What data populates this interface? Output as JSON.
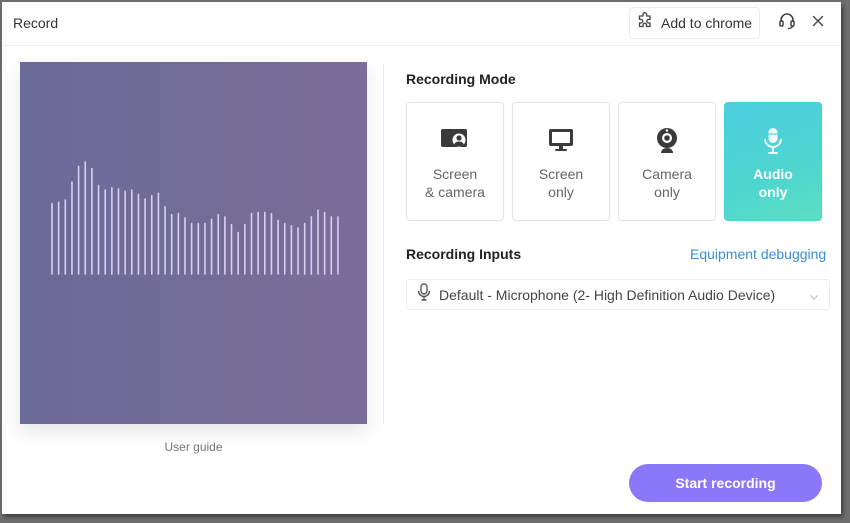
{
  "window": {
    "title": "Record",
    "add_to_chrome_label": "Add to chrome",
    "support_icon": "headset-icon",
    "close_icon": "close-icon"
  },
  "preview": {
    "user_guide_label": "User guide",
    "waveform_levels": [
      0.63,
      0.64,
      0.66,
      0.82,
      0.96,
      1.0,
      0.94,
      0.79,
      0.75,
      0.77,
      0.76,
      0.74,
      0.75,
      0.71,
      0.67,
      0.7,
      0.72,
      0.6,
      0.53,
      0.54,
      0.5,
      0.45,
      0.45,
      0.45,
      0.49,
      0.53,
      0.51,
      0.44,
      0.37,
      0.44,
      0.54,
      0.55,
      0.55,
      0.54,
      0.48,
      0.45,
      0.43,
      0.41,
      0.45,
      0.51,
      0.57,
      0.55,
      0.51,
      0.51
    ]
  },
  "recording_mode": {
    "title": "Recording Mode",
    "options": [
      {
        "label_line1": "Screen",
        "label_line2": "& camera",
        "icon": "screen-camera-icon",
        "active": false
      },
      {
        "label_line1": "Screen",
        "label_line2": "only",
        "icon": "monitor-icon",
        "active": false
      },
      {
        "label_line1": "Camera",
        "label_line2": "only",
        "icon": "webcam-icon",
        "active": false
      },
      {
        "label_line1": "Audio",
        "label_line2": "only",
        "icon": "microphone-icon",
        "active": true
      }
    ]
  },
  "recording_inputs": {
    "title": "Recording Inputs",
    "equipment_link": "Equipment debugging",
    "microphone_value": "Default - Microphone (2- High Definition Audio Device)"
  },
  "actions": {
    "start_label": "Start recording"
  },
  "colors": {
    "accent_button": "#8a78f8",
    "active_card": "#4dd6cf",
    "link": "#3a8fd6",
    "preview_bg": "#736b98"
  }
}
